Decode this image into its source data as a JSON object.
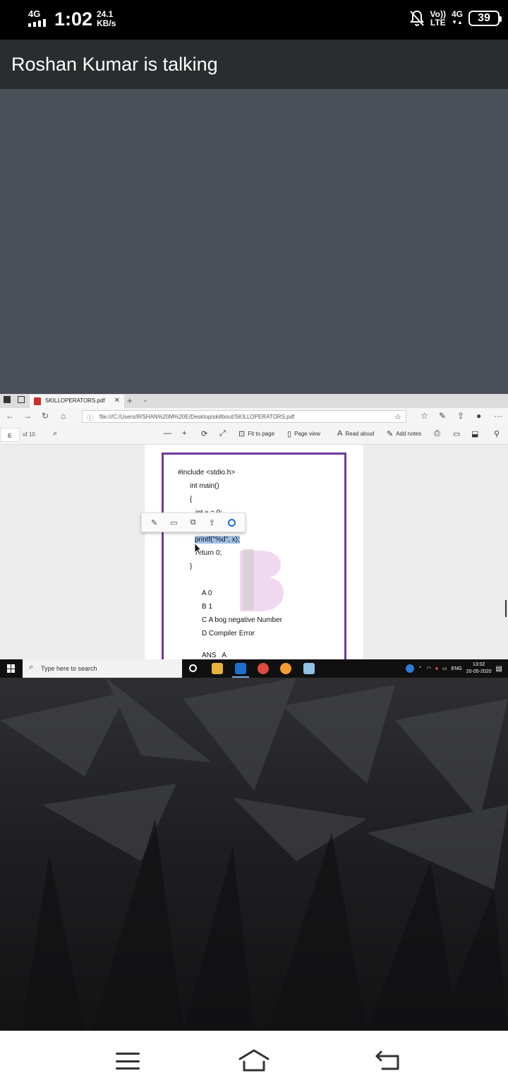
{
  "status_bar": {
    "network": "4G",
    "time": "1:02",
    "speed_value": "24.1",
    "speed_unit": "KB/s",
    "volte_top": "Vo))",
    "volte_bottom": "LTE",
    "net_right_top": "4G",
    "net_right_bottom": "▼▲",
    "battery": "39"
  },
  "call_banner": {
    "title": "Roshan Kumar is talking"
  },
  "shared_screen": {
    "browser": {
      "tab_title": "SKILLOPERATORS.pdf",
      "tab_close": "✕",
      "new_tab": "+",
      "url": "file:///C:/Users/IRSHAN%20M%20E/Desktop/skillbout/SKILLOPERATORS.pdf"
    },
    "pdf_toolbar": {
      "page_number": "6",
      "page_of": "of 10",
      "zoom_out": "—",
      "zoom_in": "+",
      "fit_to_page": "Fit to page",
      "page_view": "Page view",
      "read_aloud": "Read aloud",
      "add_notes": "Add notes"
    },
    "pdf_content": {
      "lines": [
        "#include <stdio.h>",
        "int main()",
        "{",
        "int x = 0;",
        "printf(\"%d\", x);",
        "return 0;",
        "}",
        "A 0",
        "B 1",
        "C A bog negative Number",
        "D Compiler Error",
        "ANS   A"
      ]
    },
    "taskbar": {
      "search_placeholder": "Type here to search",
      "language": "ENG",
      "clock_time": "13:02",
      "clock_date": "20-05-2020"
    }
  },
  "colors": {
    "pdf_frame": "#6f3a9c",
    "selection": "#9ec0e8",
    "banner_bg": "#2a2c2f",
    "grey_area": "#4b5058"
  },
  "icons": [
    "signal-icon",
    "mute-bell-icon",
    "battery-icon",
    "pdf-file-icon",
    "back-arrow-icon",
    "forward-arrow-icon",
    "refresh-icon",
    "home-icon",
    "star-icon",
    "search-icon",
    "print-icon",
    "save-icon",
    "windows-logo-icon",
    "menu-icon",
    "phone-home-icon",
    "phone-back-icon"
  ]
}
